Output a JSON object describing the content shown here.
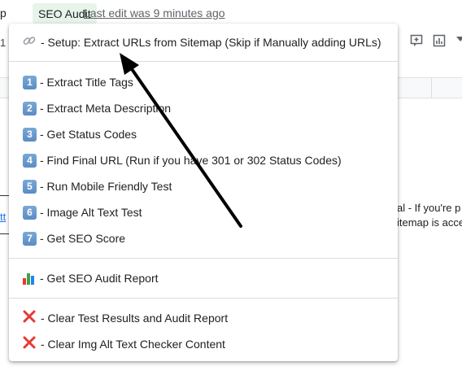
{
  "menubar": {
    "prev_menu": "p",
    "active_menu": "SEO Audit",
    "last_edit": "Last edit was 9 minutes ago"
  },
  "toolbar": {
    "left_fragment": "1",
    "icons": [
      "insert-comment-icon",
      "insert-chart-icon",
      "filter-icon"
    ]
  },
  "sheet": {
    "text_right_1": "al - If you're p",
    "text_right_2": "itemap is acce",
    "left_link": "tt"
  },
  "dropdown": {
    "items": [
      {
        "icon": "link-icon",
        "label": "- Setup: Extract URLs from Sitemap (Skip if Manually adding URLs)"
      },
      {
        "icon": "keycap-1-icon",
        "badge": "1",
        "label": "- Extract Title Tags"
      },
      {
        "icon": "keycap-2-icon",
        "badge": "2",
        "label": "- Extract Meta Description"
      },
      {
        "icon": "keycap-3-icon",
        "badge": "3",
        "label": "- Get Status Codes"
      },
      {
        "icon": "keycap-4-icon",
        "badge": "4",
        "label": "- Find Final URL (Run if you have 301 or 302 Status Codes)"
      },
      {
        "icon": "keycap-5-icon",
        "badge": "5",
        "label": "- Run Mobile Friendly Test"
      },
      {
        "icon": "keycap-6-icon",
        "badge": "6",
        "label": "- Image Alt Text Test"
      },
      {
        "icon": "keycap-7-icon",
        "badge": "7",
        "label": "- Get SEO Score"
      },
      {
        "icon": "bar-chart-icon",
        "label": "- Get SEO Audit Report"
      },
      {
        "icon": "cross-mark-icon",
        "label": "- Clear Test Results and Audit Report"
      },
      {
        "icon": "cross-mark-icon",
        "label": "- Clear Img Alt Text Checker Content"
      }
    ]
  },
  "colors": {
    "active_menu_bg": "#e6f4ea",
    "keycap": "#5b8cc4",
    "cross": "#e53935"
  }
}
